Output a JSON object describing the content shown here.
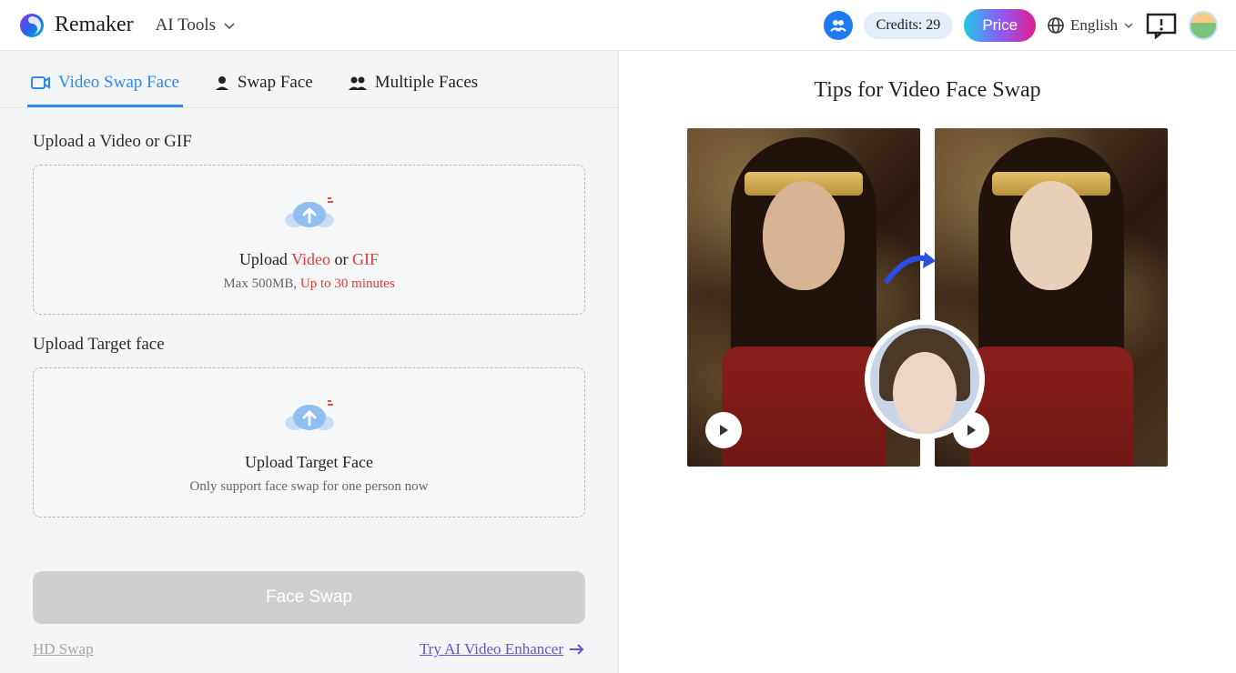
{
  "header": {
    "brand": "Remaker",
    "ai_tools_label": "AI Tools",
    "credits_label": "Credits: 29",
    "price_label": "Price",
    "language_label": "English"
  },
  "tabs": [
    {
      "label": "Video Swap Face",
      "active": true
    },
    {
      "label": "Swap Face",
      "active": false
    },
    {
      "label": "Multiple Faces",
      "active": false
    }
  ],
  "upload_video": {
    "title": "Upload a Video or GIF",
    "prefix": "Upload ",
    "video_word": "Video",
    "or_word": " or ",
    "gif_word": "GIF",
    "sub_prefix": "Max 500MB, ",
    "sub_highlight": "Up to 30 minutes"
  },
  "upload_face": {
    "title": "Upload Target face",
    "main": "Upload Target Face",
    "sub": "Only support face swap for one person now"
  },
  "actions": {
    "face_swap": "Face Swap",
    "hd_swap": "HD Swap",
    "enhancer": "Try AI Video Enhancer"
  },
  "right": {
    "title": "Tips for Video Face Swap"
  }
}
